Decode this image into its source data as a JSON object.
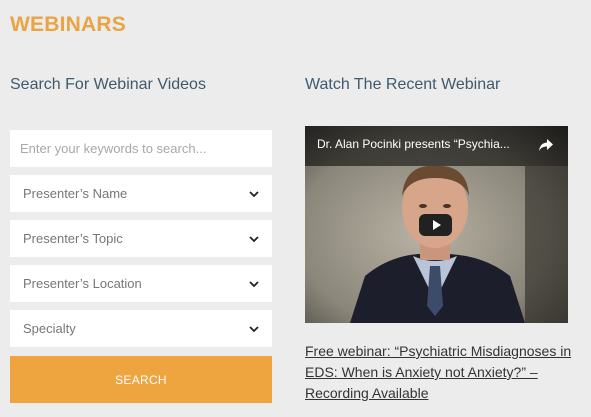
{
  "page": {
    "title": "WEBINARS"
  },
  "search": {
    "heading": "Search For Webinar Videos",
    "placeholder": "Enter your keywords to search...",
    "selects": [
      {
        "label": "Presenter’s Name"
      },
      {
        "label": "Presenter’s Topic"
      },
      {
        "label": "Presenter’s Location"
      },
      {
        "label": "Specialty"
      }
    ],
    "button_label": "SEARCH"
  },
  "recent": {
    "heading": "Watch The Recent Webinar",
    "video_title": "Dr. Alan Pocinki presents “Psychia...",
    "link_text": "Free webinar: “Psychiatric Misdiagnoses in EDS: When is Anxiety not Anxiety?” – Recording Available"
  },
  "colors": {
    "accent": "#e9a443",
    "button": "#eea53f",
    "heading": "#3f5a6e",
    "background": "#ececec"
  },
  "icons": [
    "chevron-down-icon",
    "share-icon",
    "play-icon"
  ]
}
